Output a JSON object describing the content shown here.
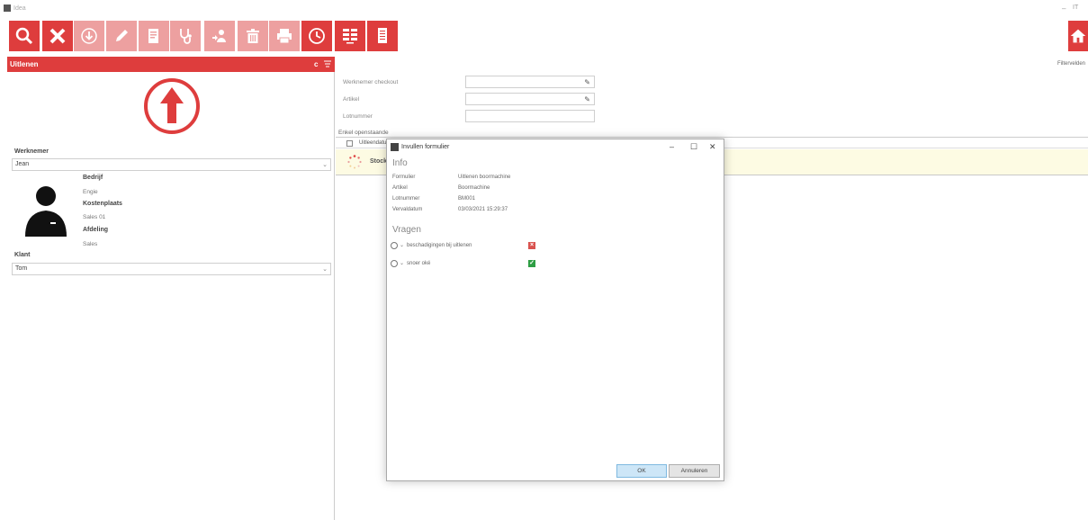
{
  "window": {
    "title": "Idea",
    "extra": "IT"
  },
  "toolbar": {
    "buttons": [
      {
        "icon": "search-icon",
        "state": "active"
      },
      {
        "icon": "close-icon",
        "state": "active"
      },
      {
        "icon": "download-icon",
        "state": "disabled"
      },
      {
        "icon": "edit-icon",
        "state": "disabled"
      },
      {
        "icon": "document-icon",
        "state": "disabled"
      },
      {
        "icon": "stethoscope-icon",
        "state": "disabled"
      },
      {
        "icon": "user-transfer-icon",
        "state": "disabled"
      },
      {
        "icon": "trash-icon",
        "state": "disabled"
      },
      {
        "icon": "print-icon",
        "state": "disabled"
      },
      {
        "icon": "clock-icon",
        "state": "active"
      },
      {
        "icon": "layout-icon",
        "state": "active"
      },
      {
        "icon": "form-icon",
        "state": "active"
      },
      {
        "icon": "home-icon",
        "state": "active"
      }
    ]
  },
  "left_panel": {
    "title": "Uitlenen",
    "header_letter": "c",
    "employee_label": "Werknemer",
    "employee_value": "Jean",
    "company_label": "Bedrijf",
    "company_value": "Engie",
    "cost_center_label": "Kostenplaats",
    "cost_center_value": "Sales 01",
    "department_label": "Afdeling",
    "department_value": "Sales",
    "client_label": "Klant",
    "client_value": "Tom"
  },
  "right_form": {
    "checkout_label": "Werknemer checkout",
    "article_label": "Artikel",
    "lot_label": "Lotnummer",
    "open_only_label": "Enkel openstaande",
    "grid_column": "Uitleendatum",
    "row_status": "Stock",
    "filter_fields_label": "Filtervelden"
  },
  "dialog": {
    "title": "Invullen formulier",
    "info_heading": "Info",
    "fields": [
      {
        "label": "Formulier",
        "value": "Uitlenen boormachine"
      },
      {
        "label": "Artikel",
        "value": "Boormachine"
      },
      {
        "label": "Lotnummer",
        "value": "BM001"
      },
      {
        "label": "Vervaldatum",
        "value": "03/03/2021 15:29:37"
      }
    ],
    "questions_heading": "Vragen",
    "questions": [
      {
        "text": "beschadigingen bij uitlenen",
        "answer": "no"
      },
      {
        "text": "snoer oké",
        "answer": "yes"
      }
    ],
    "ok_label": "OK",
    "cancel_label": "Annuleren"
  },
  "colors": {
    "accent": "#de3d3d",
    "accent_disabled": "#eda0a0",
    "highlight_row": "#fdfbe3"
  }
}
